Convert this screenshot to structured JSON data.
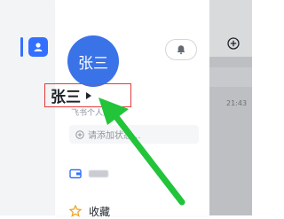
{
  "profile": {
    "avatar_text": "张三",
    "name": "张三",
    "subtitle": "飞书个人账号"
  },
  "status_input": {
    "placeholder": "请添加状态..."
  },
  "menu": {
    "items": [
      {
        "label": "",
        "icon": "wallet-icon"
      },
      {
        "label": "收藏",
        "icon": "star-icon"
      }
    ]
  },
  "chat_preview": {
    "time": "21:43"
  },
  "colors": {
    "accent": "#3370ff",
    "highlight_box": "#e23b3b",
    "annotation_arrow": "#22c43a"
  }
}
